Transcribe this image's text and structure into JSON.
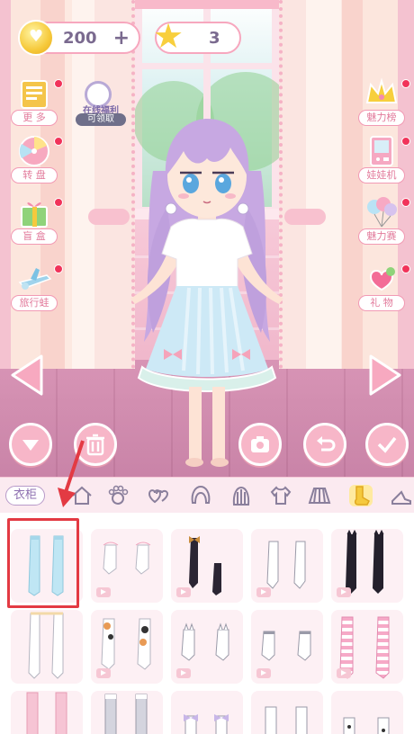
{
  "currency": {
    "hearts": {
      "icon": "heart-coin-icon",
      "value": "200",
      "plus": "+"
    },
    "stars": {
      "icon": "star-icon",
      "value": "3"
    }
  },
  "left_menu": [
    {
      "id": "more",
      "label": "更 多",
      "icon": "notebook-icon"
    },
    {
      "id": "wheel",
      "label": "转 盘",
      "icon": "wheel-icon"
    },
    {
      "id": "blindbox",
      "label": "盲 盒",
      "icon": "gift-icon"
    },
    {
      "id": "trip",
      "label": "旅行蛙",
      "icon": "plane-icon"
    }
  ],
  "online_reward": {
    "title": "在线福利",
    "status": "可领取",
    "icon": "clock-icon"
  },
  "right_menu": [
    {
      "id": "charm",
      "label": "魅力榜",
      "icon": "crown-icon"
    },
    {
      "id": "claw",
      "label": "娃娃机",
      "icon": "claw-machine-icon"
    },
    {
      "id": "charm2",
      "label": "魅力赛",
      "icon": "balloons-icon"
    },
    {
      "id": "gift",
      "label": "礼 物",
      "icon": "gift-heart-icon"
    }
  ],
  "actions": [
    "arrow-down-icon",
    "trash-icon",
    "camera-icon",
    "undo-icon",
    "check-icon"
  ],
  "category_bar": {
    "wardrobe_label": "衣柜",
    "categories": [
      "home-icon",
      "paw-icon",
      "hearts-icon",
      "hair-icon",
      "hair-back-icon",
      "top-icon",
      "skirt-icon",
      "socks-icon",
      "shoes-icon"
    ],
    "selected": "socks-icon"
  },
  "colors": {
    "accent": "#f7a7be",
    "highlight": "#e33a43"
  }
}
